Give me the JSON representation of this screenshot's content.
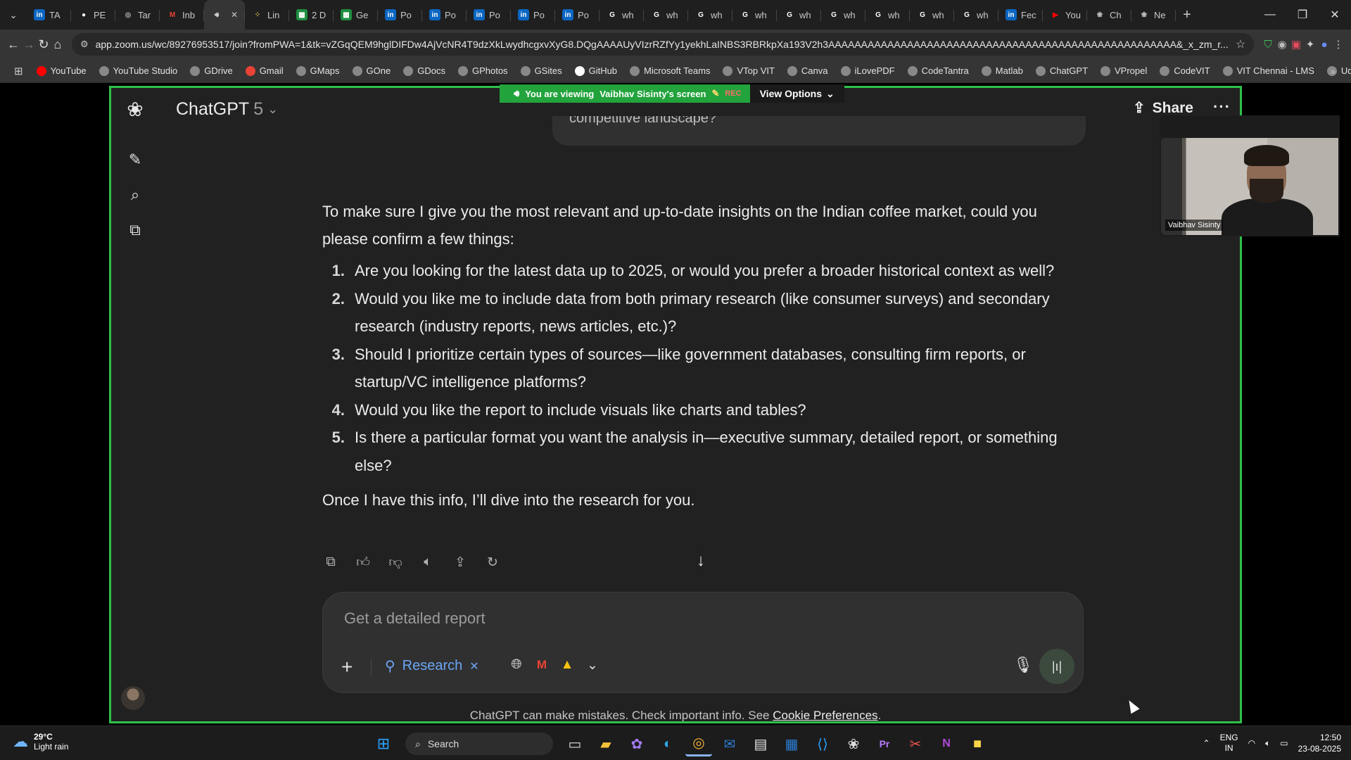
{
  "browser": {
    "tabs": [
      {
        "label": "TA",
        "icon": "linkedin-icon",
        "color": "#0a66c2"
      },
      {
        "label": "PE",
        "icon": "github-icon",
        "color": "#ffffff"
      },
      {
        "label": "Tar",
        "icon": "globe-icon",
        "color": "#888888"
      },
      {
        "label": "Inb",
        "icon": "gmail-icon",
        "color": "#ea4335"
      },
      {
        "label": "",
        "icon": "speaker-icon",
        "color": "#cccccc",
        "active": true
      },
      {
        "label": "Lin",
        "icon": "grid-icon",
        "color": "#f2c94c"
      },
      {
        "label": "2 D",
        "icon": "sheets-icon",
        "color": "#1e8e3e"
      },
      {
        "label": "Ge",
        "icon": "sheets-icon",
        "color": "#1e8e3e"
      },
      {
        "label": "Po",
        "icon": "linkedin-icon",
        "color": "#0a66c2"
      },
      {
        "label": "Po",
        "icon": "linkedin-icon",
        "color": "#0a66c2"
      },
      {
        "label": "Po",
        "icon": "linkedin-icon",
        "color": "#0a66c2"
      },
      {
        "label": "Po",
        "icon": "linkedin-icon",
        "color": "#0a66c2"
      },
      {
        "label": "Po",
        "icon": "linkedin-icon",
        "color": "#0a66c2"
      },
      {
        "label": "wh",
        "icon": "google-icon",
        "color": "#ffffff"
      },
      {
        "label": "wh",
        "icon": "google-icon",
        "color": "#ffffff"
      },
      {
        "label": "wh",
        "icon": "google-icon",
        "color": "#ffffff"
      },
      {
        "label": "wh",
        "icon": "google-icon",
        "color": "#ffffff"
      },
      {
        "label": "wh",
        "icon": "google-icon",
        "color": "#ffffff"
      },
      {
        "label": "wh",
        "icon": "google-icon",
        "color": "#ffffff"
      },
      {
        "label": "wh",
        "icon": "google-icon",
        "color": "#ffffff"
      },
      {
        "label": "wh",
        "icon": "google-icon",
        "color": "#ffffff"
      },
      {
        "label": "wh",
        "icon": "google-icon",
        "color": "#ffffff"
      },
      {
        "label": "Fec",
        "icon": "linkedin-icon",
        "color": "#0a66c2"
      },
      {
        "label": "You",
        "icon": "youtube-icon",
        "color": "#ff0000"
      },
      {
        "label": "Ch",
        "icon": "openai-icon",
        "color": "#cccccc"
      },
      {
        "label": "Ne",
        "icon": "openai-icon",
        "color": "#cccccc"
      }
    ],
    "url": "app.zoom.us/wc/89276953517/join?fromPWA=1&tk=vZGqQEM9hglDIFDw4AjVcNR4T9dzXkLwydhcgxvXyG8.DQgAAAAUyVIzrRZfYy1yekhLaINBS3RBRkpXa193V2h3AAAAAAAAAAAAAAAAAAAAAAAAAAAAAAAAAAAAAAAAAAAAAAAAAAAAA&_x_zm_r...",
    "bookmarks": [
      {
        "label": "YouTube",
        "color": "#ff0000"
      },
      {
        "label": "YouTube Studio",
        "color": "#888888"
      },
      {
        "label": "GDrive",
        "color": "#888888"
      },
      {
        "label": "Gmail",
        "color": "#ea4335"
      },
      {
        "label": "GMaps",
        "color": "#888888"
      },
      {
        "label": "GOne",
        "color": "#888888"
      },
      {
        "label": "GDocs",
        "color": "#888888"
      },
      {
        "label": "GPhotos",
        "color": "#888888"
      },
      {
        "label": "GSites",
        "color": "#888888"
      },
      {
        "label": "GitHub",
        "color": "#ffffff"
      },
      {
        "label": "Microsoft Teams",
        "color": "#888888"
      },
      {
        "label": "VTop VIT",
        "color": "#888888"
      },
      {
        "label": "Canva",
        "color": "#888888"
      },
      {
        "label": "iLovePDF",
        "color": "#888888"
      },
      {
        "label": "CodeTantra",
        "color": "#888888"
      },
      {
        "label": "Matlab",
        "color": "#888888"
      },
      {
        "label": "ChatGPT",
        "color": "#888888"
      },
      {
        "label": "VPropel",
        "color": "#888888"
      },
      {
        "label": "CodeVIT",
        "color": "#888888"
      },
      {
        "label": "VIT Chennai - LMS",
        "color": "#888888"
      },
      {
        "label": "Udemy",
        "color": "#888888"
      }
    ]
  },
  "zoom": {
    "viewing_text": "You are viewing",
    "presenter": "Vaibhav Sisinty's screen",
    "rec": "REC",
    "view_options": "View Options",
    "video_name": "Vaibhav Sisinty"
  },
  "chatgpt": {
    "title": "ChatGPT",
    "version": "5",
    "share": "Share",
    "user_bubble_tail": "competitive landscape?",
    "intro": "To make sure I give you the most relevant and up-to-date insights on the Indian coffee market, could you please confirm a few things:",
    "questions": [
      {
        "num": "1.",
        "text": "Are you looking for the latest data up to 2025, or would you prefer a broader historical context as well?"
      },
      {
        "num": "2.",
        "text": "Would you like me to include data from both primary research (like consumer surveys) and secondary research (industry reports, news articles, etc.)?"
      },
      {
        "num": "3.",
        "text": "Should I prioritize certain types of sources—like government databases, consulting firm reports, or startup/VC intelligence platforms?"
      },
      {
        "num": "4.",
        "text": "Would you like the report to include visuals like charts and tables?"
      },
      {
        "num": "5.",
        "text": "Is there a particular format you want the analysis in—executive summary, detailed report, or something else?"
      }
    ],
    "outro": "Once I have this info, I’ll dive into the research for you.",
    "composer_placeholder": "Get a detailed report",
    "research_label": "Research",
    "disclaimer": "ChatGPT can make mistakes. Check important info. See",
    "cookie_link": "Cookie Preferences",
    "accent": "#6ba6f5"
  },
  "taskbar": {
    "temperature": "29°C",
    "weather": "Light rain",
    "search": "Search",
    "lang1": "ENG",
    "lang2": "IN",
    "time": "12:50",
    "date": "23-08-2025"
  }
}
